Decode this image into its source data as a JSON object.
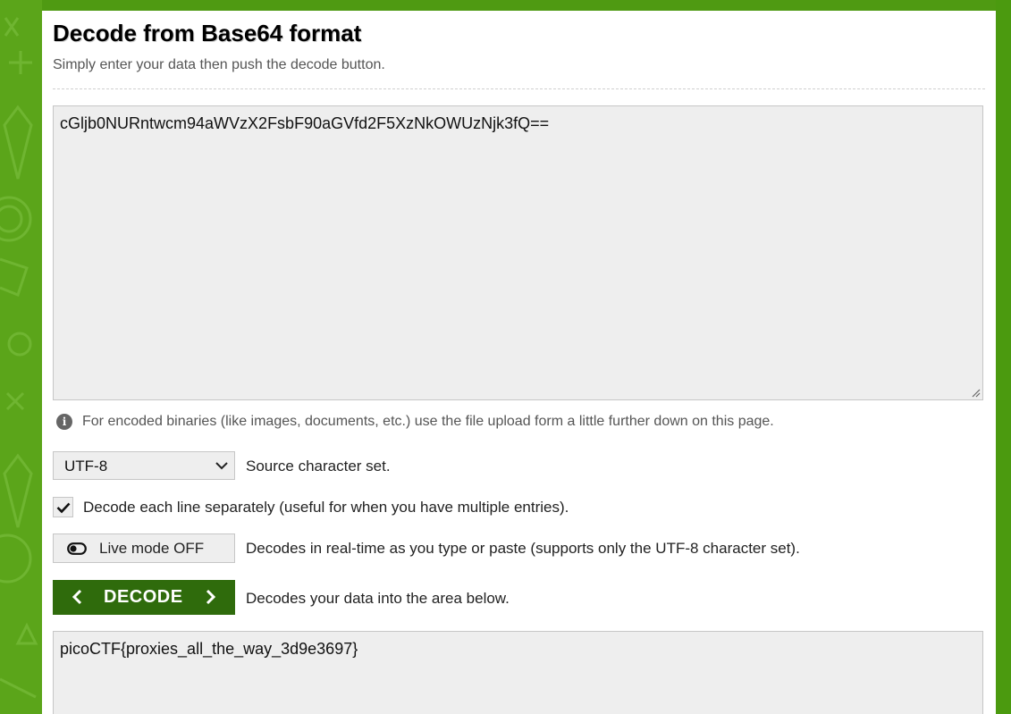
{
  "header": {
    "title": "Decode from Base64 format",
    "subtitle": "Simply enter your data then push the decode button."
  },
  "input": {
    "value": "cGljb0NURntwcm94aWVzX2FsbF90aGVfd2F5XzNkOWUzNjk3fQ=="
  },
  "info": {
    "text": "For encoded binaries (like images, documents, etc.) use the file upload form a little further down on this page."
  },
  "charset": {
    "selected": "UTF-8",
    "label": "Source character set."
  },
  "line_option": {
    "checked": true,
    "label": "Decode each line separately (useful for when you have multiple entries)."
  },
  "live_mode": {
    "label": "Live mode OFF",
    "description": "Decodes in real-time as you type or paste (supports only the UTF-8 character set)."
  },
  "decode": {
    "label": "DECODE",
    "description": "Decodes your data into the area below."
  },
  "output": {
    "value": "picoCTF{proxies_all_the_way_3d9e3697}"
  },
  "colors": {
    "brand_green": "#4f9a12",
    "button_green": "#2f6b0c"
  }
}
